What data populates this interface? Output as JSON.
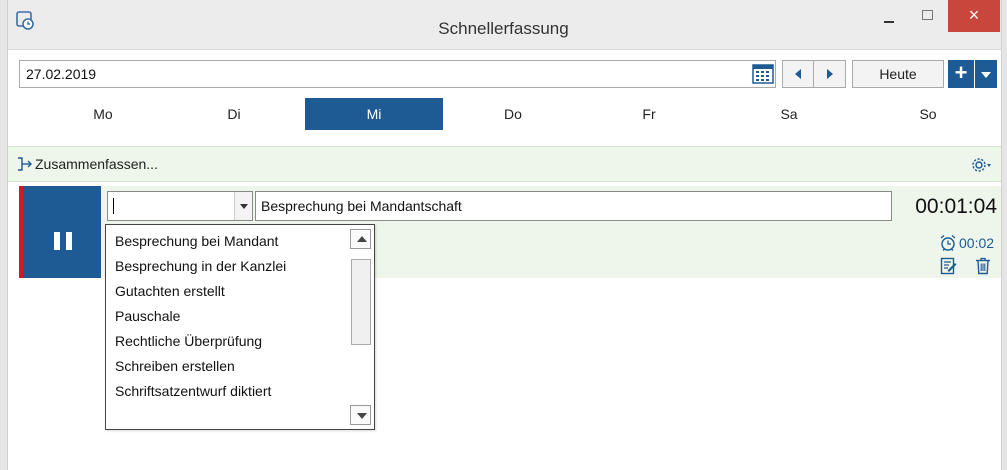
{
  "window": {
    "title": "Schnellerfassung",
    "close_glyph": "×",
    "icons": {
      "app": "app-clock-icon",
      "minimize": "minimize-icon",
      "maximize": "maximize-icon",
      "close": "close-icon"
    }
  },
  "date_bar": {
    "date_value": "27.02.2019",
    "today_label": "Heute",
    "add_glyph": "+",
    "icons": {
      "calendar": "calendar-icon",
      "prev": "chevron-left-icon",
      "next": "chevron-right-icon",
      "add_menu": "chevron-down-icon"
    }
  },
  "weekdays": {
    "items": [
      "Mo",
      "Di",
      "Mi",
      "Do",
      "Fr",
      "Sa",
      "So"
    ],
    "selected": "Mi"
  },
  "toolbar": {
    "merge_label": "Zusammenfassen...",
    "icons": {
      "merge": "merge-arrow-icon",
      "settings": "gear-dropdown-icon"
    }
  },
  "entry": {
    "activity_value": "",
    "description_value": "Besprechung bei Mandantschaft",
    "elapsed_time": "00:01:04",
    "alarm_time": "00:02",
    "icons": {
      "pause": "pause-icon",
      "alarm": "alarm-clock-icon",
      "edit": "edit-icon",
      "delete": "trash-icon"
    }
  },
  "activity_dropdown": {
    "options": [
      "Besprechung bei Mandant",
      "Besprechung in der Kanzlei",
      "Gutachten erstellt",
      "Pauschale",
      "Rechtliche Überprüfung",
      "Schreiben erstellen",
      "Schriftsatzentwurf diktiert"
    ]
  },
  "colors": {
    "accent_blue": "#1e5b94",
    "running_red": "#c51e24",
    "light_green_bg": "#eef5ea",
    "close_red": "#c9463d"
  }
}
